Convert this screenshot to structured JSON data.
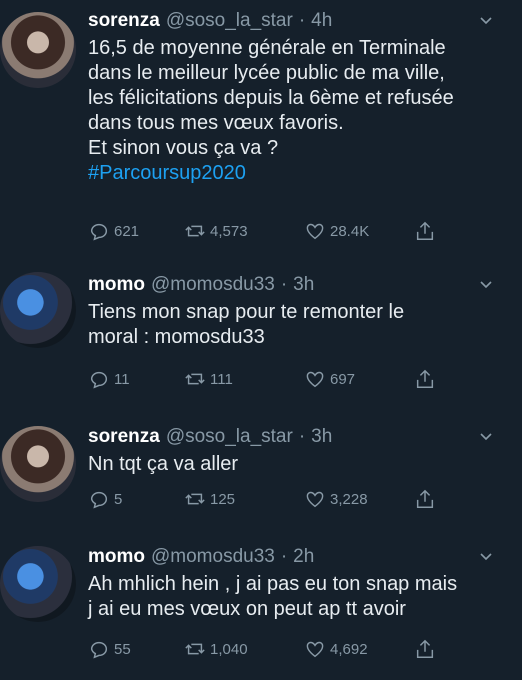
{
  "tweets": [
    {
      "name": "sorenza",
      "handle": "@soso_la_star",
      "dot": "·",
      "time": "4h",
      "lines": [
        "16,5 de moyenne générale en Terminale",
        "dans le meilleur lycée public de ma ville,",
        "les félicitations depuis la 6ème et refusée",
        "dans tous mes vœux favoris.",
        "Et sinon vous ça va ?"
      ],
      "hashtag": "#Parcoursup2020",
      "replies": "621",
      "retweets": "4,573",
      "likes": "28.4K"
    },
    {
      "name": "momo",
      "handle": "@momosdu33",
      "dot": "·",
      "time": "3h",
      "lines": [
        "Tiens mon snap pour te remonter le",
        "moral : momosdu33"
      ],
      "replies": "11",
      "retweets": "111",
      "likes": "697"
    },
    {
      "name": "sorenza",
      "handle": "@soso_la_star",
      "dot": "·",
      "time": "3h",
      "lines": [
        "Nn tqt ça va aller"
      ],
      "replies": "5",
      "retweets": "125",
      "likes": "3,228"
    },
    {
      "name": "momo",
      "handle": "@momosdu33",
      "dot": "·",
      "time": "2h",
      "lines": [
        "Ah mhlich hein , j ai pas eu ton snap mais",
        "j ai eu mes vœux on peut ap tt avoir"
      ],
      "replies": "55",
      "retweets": "1,040",
      "likes": "4,692"
    }
  ]
}
